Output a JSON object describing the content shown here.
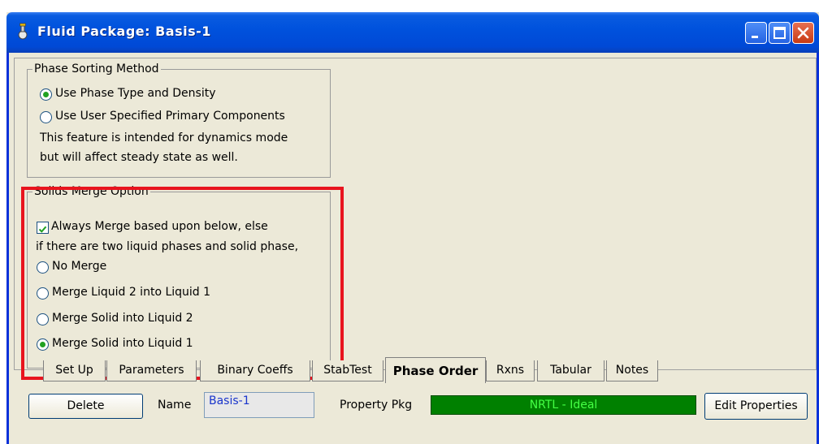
{
  "window": {
    "title": "Fluid Package: Basis-1"
  },
  "phase_sorting": {
    "legend": "Phase Sorting Method",
    "options": [
      "Use Phase Type and Density",
      "Use User Specified Primary Components"
    ],
    "selected": "Use Phase Type and Density",
    "note_line1": "This feature is intended for dynamics mode",
    "note_line2": "but will affect steady state as well."
  },
  "solids_merge": {
    "legend": "Solids Merge Option",
    "always_merge_label": "Always Merge based upon below, else",
    "always_merge_checked": true,
    "condition_text": "if there are two liquid phases and solid phase,",
    "options": [
      "No Merge",
      "Merge Liquid 2 into Liquid 1",
      "Merge Solid into Liquid 2",
      "Merge Solid into Liquid 1"
    ],
    "selected": "Merge Solid into Liquid 1"
  },
  "tabs": [
    "Set Up",
    "Parameters",
    "Binary Coeffs",
    "StabTest",
    "Phase Order",
    "Rxns",
    "Tabular",
    "Notes"
  ],
  "active_tab": "Phase Order",
  "bottom": {
    "delete_label": "Delete",
    "name_label": "Name",
    "name_value": "Basis-1",
    "property_pkg_label": "Property Pkg",
    "property_pkg_value": "NRTL - Ideal",
    "edit_properties_label": "Edit Properties"
  },
  "colors": {
    "highlight": "#e8141e",
    "property_pkg_bg": "#008000",
    "radio_dot": "#21a121",
    "titlebar": "#0052dd"
  }
}
